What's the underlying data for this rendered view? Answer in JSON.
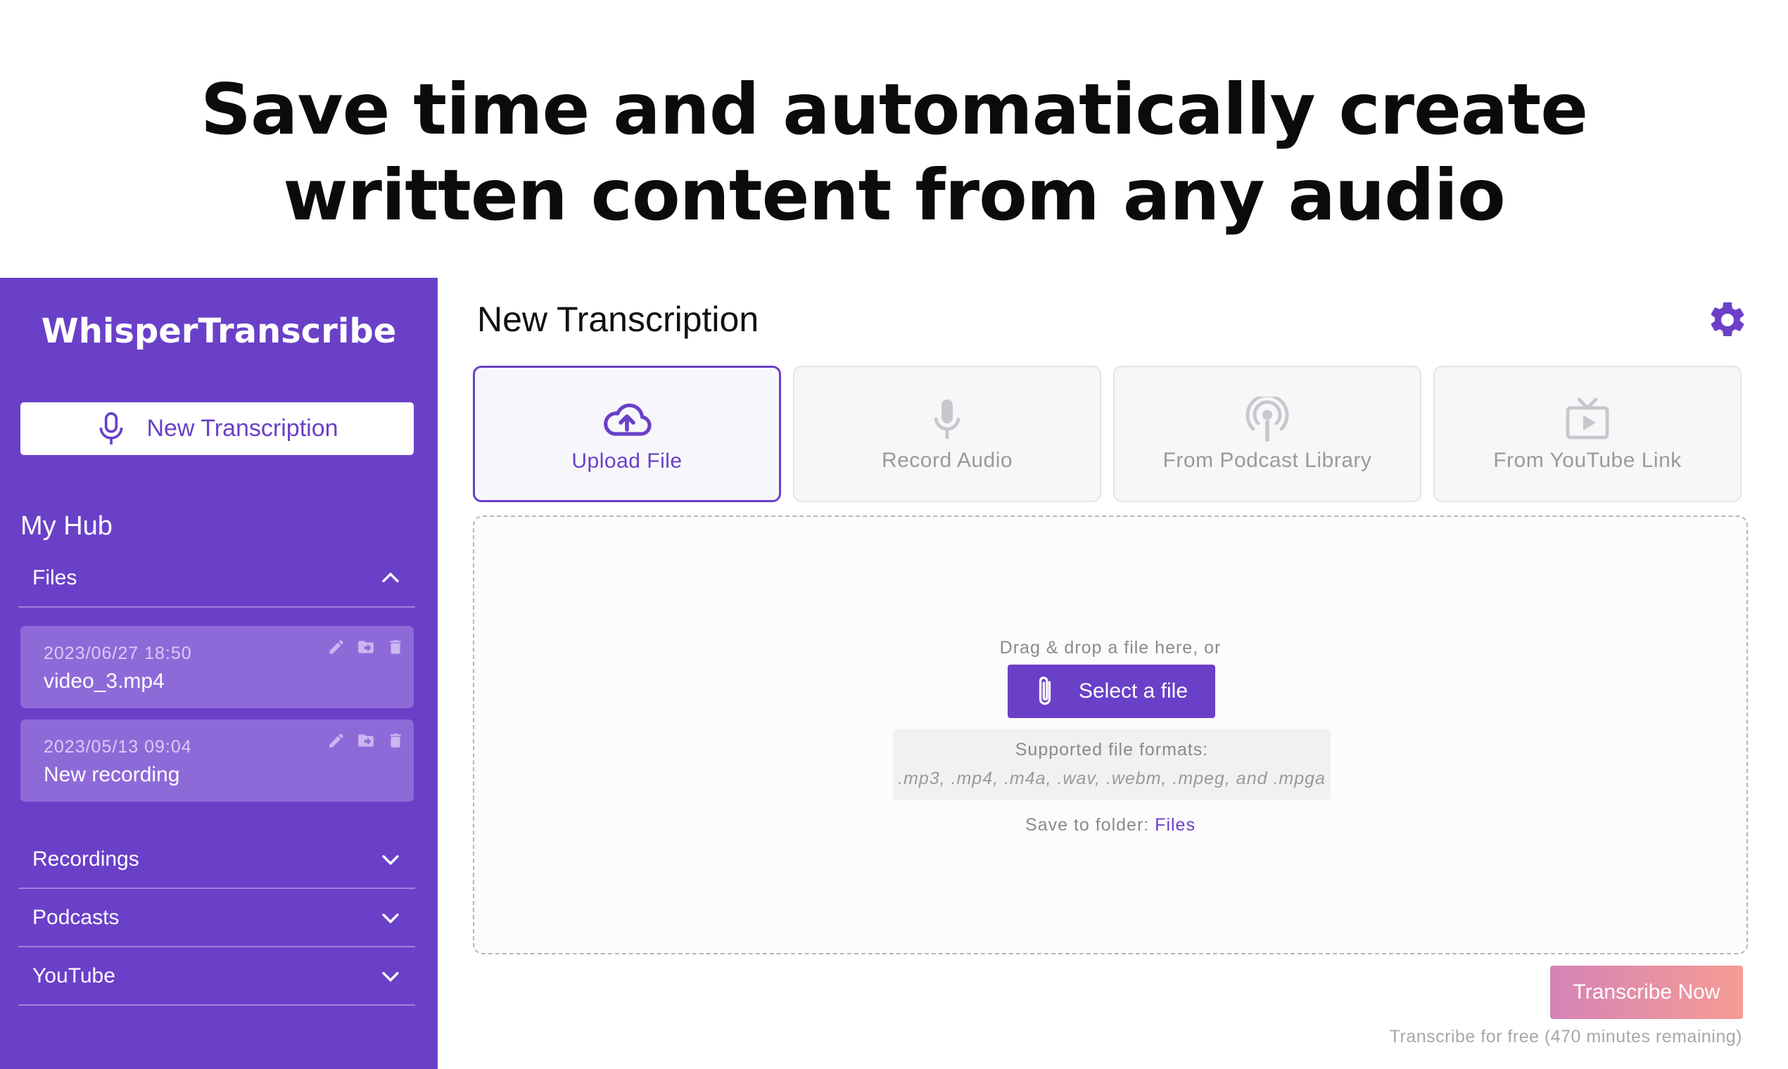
{
  "hero": {
    "line1": "Save time and automatically create",
    "line2": "written content from any audio"
  },
  "sidebar": {
    "brand": "WhisperTranscribe",
    "new_button_label": "New Transcription",
    "hub_title": "My Hub",
    "sections": [
      {
        "label": "Files",
        "expanded": true
      },
      {
        "label": "Recordings",
        "expanded": false
      },
      {
        "label": "Podcasts",
        "expanded": false
      },
      {
        "label": "YouTube",
        "expanded": false
      }
    ],
    "files": [
      {
        "date": "2023/06/27 18:50",
        "name": "video_3.mp4"
      },
      {
        "date": "2023/05/13 09:04",
        "name": "New recording"
      }
    ]
  },
  "main": {
    "title": "New Transcription",
    "tabs": [
      {
        "label": "Upload File",
        "icon": "cloud-upload-icon",
        "active": true
      },
      {
        "label": "Record Audio",
        "icon": "microphone-icon",
        "active": false
      },
      {
        "label": "From Podcast Library",
        "icon": "podcast-icon",
        "active": false
      },
      {
        "label": "From YouTube Link",
        "icon": "tv-play-icon",
        "active": false
      }
    ],
    "dropzone": {
      "drag_text": "Drag & drop a file here, or",
      "select_label": "Select a file",
      "formats_title": "Supported file formats:",
      "formats_list": ".mp3, .mp4, .m4a, .wav, .webm, .mpeg, and .mpga",
      "save_to_prefix": "Save to folder:",
      "save_to_folder": "Files"
    },
    "transcribe_label": "Transcribe Now",
    "free_note": "Transcribe for free (470 minutes remaining)"
  },
  "colors": {
    "accent": "#6a40c8",
    "card": "#8e6ad9",
    "gradient_start": "#d583b6",
    "gradient_end": "#f59c95"
  }
}
